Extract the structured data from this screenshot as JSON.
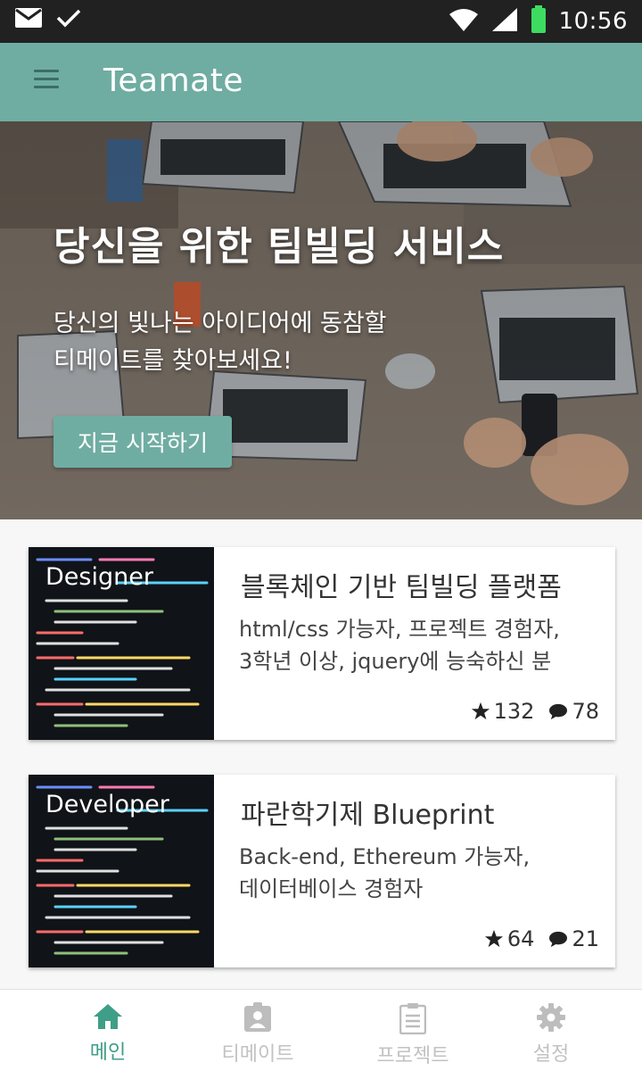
{
  "status_bar": {
    "time": "10:56"
  },
  "app_bar": {
    "title": "Teamate"
  },
  "hero": {
    "title": "당신을 위한 팀빌딩 서비스",
    "subtitle_line1": "당신의 빛나는 아이디어에 동참할",
    "subtitle_line2": "티메이트를 찾아보세요!",
    "cta_label": "지금 시작하기"
  },
  "cards": [
    {
      "role": "Designer",
      "title": "블록체인 기반 팀빌딩 플랫폼",
      "desc_line1": "html/css 가능자, 프로젝트 경험자,",
      "desc_line2": "3학년 이상, jquery에 능숙하신 분",
      "stars": "132",
      "comments": "78"
    },
    {
      "role": "Developer",
      "title": "파란학기제 Blueprint",
      "desc_line1": "Back-end, Ethereum 가능자,",
      "desc_line2": "데이터베이스 경험자",
      "stars": "64",
      "comments": "21"
    }
  ],
  "bottom_nav": {
    "items": [
      {
        "label": "메인",
        "icon": "home-icon",
        "active": true
      },
      {
        "label": "티메이트",
        "icon": "badge-icon",
        "active": false
      },
      {
        "label": "프로젝트",
        "icon": "clipboard-icon",
        "active": false
      },
      {
        "label": "설정",
        "icon": "gear-icon",
        "active": false
      }
    ]
  },
  "colors": {
    "primary": "#6fada2",
    "active_nav": "#3f9e87",
    "status_bar": "#212121"
  }
}
